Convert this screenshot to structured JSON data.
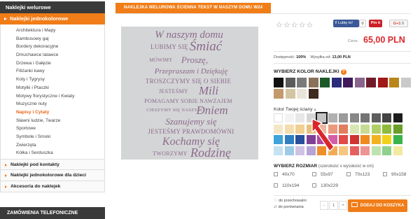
{
  "sidebar": {
    "head": "Naklejki welurowe",
    "sub": "Naklejki jednokolorowe",
    "items": [
      {
        "label": "Architektura i Mapy"
      },
      {
        "label": "Bambusowy gaj"
      },
      {
        "label": "Bordery dekoracyjne"
      },
      {
        "label": "Dmuchawce latawce"
      },
      {
        "label": "Drzewa i Gałęzie"
      },
      {
        "label": "Filiżanki kawy"
      },
      {
        "label": "Koty i Tygrysy"
      },
      {
        "label": "Motylki i Ptaszki"
      },
      {
        "label": "Motywy florystyczne i Kwiaty"
      },
      {
        "label": "Muzyczne nuty"
      },
      {
        "label": "Napisy i Cytaty",
        "active": true
      },
      {
        "label": "Sławni ludzie, Twarze"
      },
      {
        "label": "Sportowe"
      },
      {
        "label": "Symbole i Smoki"
      },
      {
        "label": "Zwierzęta"
      },
      {
        "label": "Kółka i Serduszka"
      }
    ],
    "categories": [
      {
        "label": "Naklejki pod kontakty"
      },
      {
        "label": "Naklejki jednokolorowe dla dzieci"
      },
      {
        "label": "Akcesoria do naklejek"
      }
    ],
    "phone_head": "ZAMÓWIENIA TELEFONICZNE"
  },
  "product": {
    "title": "NAKLEJKA WELUROWA ŚCIENNA TEKST W NASZYM DOMU W24",
    "wall_lines": [
      {
        "text": "W naszym domu",
        "style": "script"
      },
      {
        "text": "LUBIMY SIĘ",
        "style": "caps"
      },
      {
        "text": "Śmiać",
        "style": "script"
      },
      {
        "text": "MÓWIMY",
        "style": "caps"
      },
      {
        "text": "Proszę,",
        "style": "script"
      },
      {
        "text": "Przepraszam i Dziękuję",
        "style": "script"
      },
      {
        "text": "TROSZCZYMY SIĘ O SIEBIE",
        "style": "caps"
      },
      {
        "text": "JESTEŚMY",
        "style": "caps"
      },
      {
        "text": "Mili",
        "style": "script"
      },
      {
        "text": "POMAGAMY SOBIE NAWZAJEM",
        "style": "caps"
      },
      {
        "text": "CIESZYMY SIĘ NASZYM",
        "style": "caps"
      },
      {
        "text": "Dniem",
        "style": "script"
      },
      {
        "text": "Szanujemy się",
        "style": "script"
      },
      {
        "text": "JESTEŚMY PRAWDOMÓWNI",
        "style": "caps"
      },
      {
        "text": "Kochamy się",
        "style": "script"
      },
      {
        "text": "TWORZYMY",
        "style": "caps"
      },
      {
        "text": "Rodzinę",
        "style": "script"
      }
    ],
    "like_label": "Lubię to!",
    "like_count": "0",
    "pin_label": "Pin it",
    "gplus_label": "G+1",
    "gplus_count": "0",
    "price_label": "Cena:",
    "price": "65,00 PLN",
    "availability_label": "Dostępność:",
    "availability": "100%",
    "shipping_label": "Wysyłka od:",
    "shipping": "13,00 PLN",
    "color_title": "WYBIERZ KOLOR NAKLEJKI",
    "info_icon": "?",
    "wall_color_label": "Kolor Twojej ściany",
    "size_title": "WYBIERZ ROZMIAR",
    "size_hint": "(szerokość x wysokość w cm)",
    "sizes": [
      "40x70",
      "55x97",
      "70x123",
      "90x158",
      "110x194",
      "130x229"
    ],
    "link_storage": "do przechowalni",
    "link_compare": "do porównania",
    "qty_minus": "-",
    "qty_value": "1",
    "qty_plus": "+",
    "add_to_cart": "DODAJ DO KOSZYKA"
  },
  "colors": {
    "accent": "#f07d18",
    "price": "#d8282c",
    "sticker_colors": [
      "#111111",
      "#5b5b5b",
      "#7a7a7a",
      "#8a7158",
      "#1c5a2a",
      "#2c2c7a",
      "#3f1b5a",
      "#8a668c",
      "#6e1c2a",
      "#a01818",
      "#b8861a",
      "#c9c9c9",
      "#c49a6c",
      "#d3c4a4",
      "#e9e4d8",
      "#3f2a1d"
    ],
    "wall_colors": [
      [
        "#ffffff",
        "#f3f3f3",
        "#e7e7e7",
        "#d6d6d6",
        "#c4c4c4",
        "#b0b0b0",
        "#9b9b9b",
        "#888888",
        "#757575",
        "#5e5e5e",
        "#444444",
        "#1c1c1c"
      ],
      [
        "#f6e6c8",
        "#f3dcae",
        "#f0cf91",
        "#e8c07a",
        "#efb49b",
        "#ec9a7d",
        "#e17f5c",
        "#d9e6b2",
        "#c7dc92",
        "#b0d067",
        "#8dbb3c",
        "#6a9e28"
      ],
      [
        "#3ea4d9",
        "#2f7ec2",
        "#274f9b",
        "#7e3f96",
        "#b2469e",
        "#d25fa8",
        "#e24a4a",
        "#d13232",
        "#f08a1f",
        "#f3b21f",
        "#f0d21c",
        "#3bb34a"
      ],
      [
        "#c5e2f2",
        "#9dcbe6",
        "#d0c2e3",
        "#b7a4d6",
        "#ee8f2c",
        "#f2aa57",
        "#f5c680",
        "#e65f5f",
        "#ef9494",
        "#bde3b0",
        "#8fd08c",
        "#f3e9a0"
      ]
    ]
  }
}
